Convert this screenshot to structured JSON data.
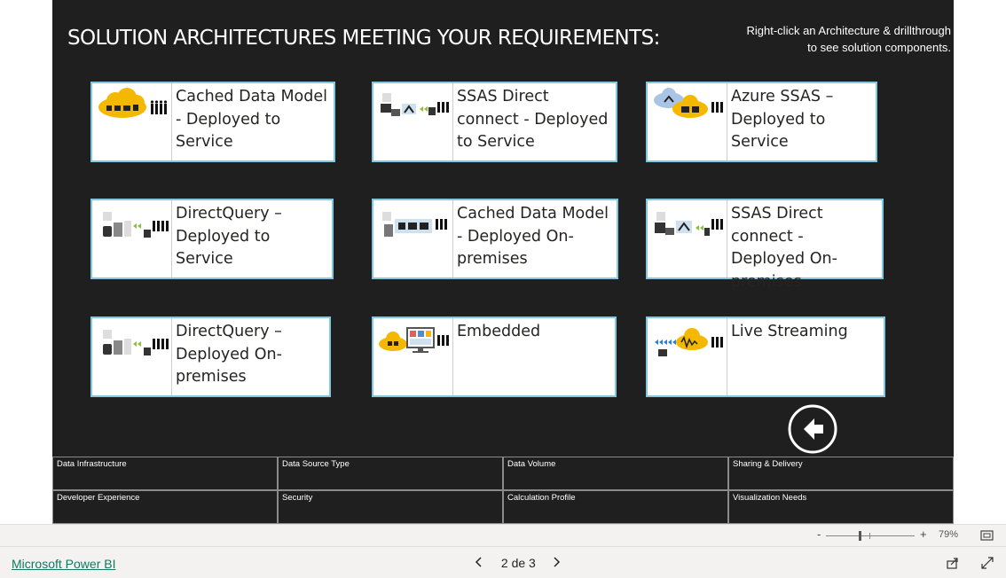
{
  "report": {
    "title": "SOLUTION ARCHITECTURES MEETING YOUR REQUIREMENTS:",
    "hint_line1": "Right-click an Architecture & drillthrough",
    "hint_line2": "to see solution components."
  },
  "cards": [
    {
      "label": "Cached Data Model - Deployed to Service",
      "icon": "cloud-model-users-icon"
    },
    {
      "label": "SSAS Direct connect - Deployed to Service",
      "icon": "ssas-gateway-icon"
    },
    {
      "label": "Azure SSAS – Deployed to Service",
      "icon": "azure-cloud-icon"
    },
    {
      "label": "DirectQuery – Deployed to Service",
      "icon": "directquery-icon"
    },
    {
      "label": "Cached Data Model - Deployed On-premises",
      "icon": "onprem-model-icon"
    },
    {
      "label": "SSAS Direct connect - Deployed On-premises",
      "icon": "ssas-onprem-icon"
    },
    {
      "label": "DirectQuery – Deployed On-premises",
      "icon": "directquery-onprem-icon"
    },
    {
      "label": "Embedded",
      "icon": "embedded-icon"
    },
    {
      "label": "Live Streaming",
      "icon": "streaming-icon"
    }
  ],
  "filters": [
    "Data Infrastructure",
    "Data Source Type",
    "Data Volume",
    "Sharing & Delivery",
    "Developer Experience",
    "Security",
    "Calculation Profile",
    "Visualization Needs"
  ],
  "zoom": {
    "minus": "-",
    "plus": "+",
    "level": "79%"
  },
  "footer": {
    "brand": "Microsoft Power BI",
    "page": "2 de 3"
  },
  "colors": {
    "card_border": "#7fc8df",
    "canvas": "#1f1f1f",
    "cloud": "#f5b800",
    "link": "#117865"
  }
}
